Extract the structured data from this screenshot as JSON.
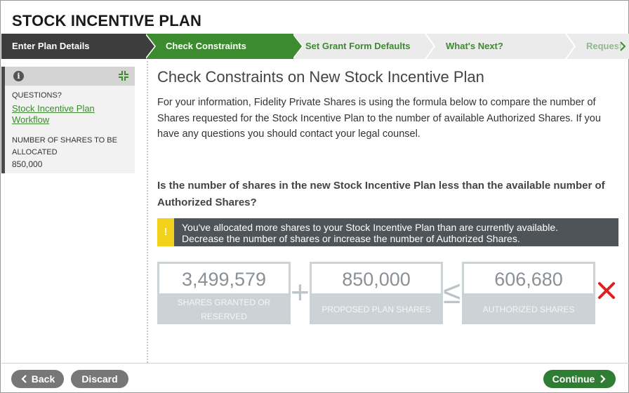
{
  "app": {
    "title": "STOCK INCENTIVE PLAN"
  },
  "stepper": {
    "steps": [
      {
        "label": "Enter Plan Details",
        "state": "done"
      },
      {
        "label": "Check Constraints",
        "state": "current"
      },
      {
        "label": "Set Grant Form Defaults",
        "state": "future"
      },
      {
        "label": "What's Next?",
        "state": "future"
      },
      {
        "label": "Request",
        "state": "future"
      }
    ],
    "overflow_icon": "chevron-right-icon"
  },
  "sidebar": {
    "info_icon": "info-icon",
    "collapse_icon": "collapse-icon",
    "questions_label": "QUESTIONS?",
    "workflow_link": "Stock Incentive Plan Workflow",
    "shares_label": "NUMBER OF SHARES TO BE ALLOCATED",
    "shares_value": "850,000"
  },
  "main": {
    "title": "Check Constraints on New Stock Incentive Plan",
    "intro": "For your information, Fidelity Private Shares is using the formula below to compare the number of Shares requested for the Stock Incentive Plan to the number of available Authorized Shares. If you have any questions you should contact your legal counsel.",
    "question": "Is the number of shares in the new Stock Incentive Plan less than the available number of Authorized Shares?",
    "warning": {
      "icon": "!",
      "line1": "You've allocated more shares to your Stock Incentive Plan than are currently available.",
      "line2": "Decrease the number of shares or increase the number of Authorized Shares."
    },
    "formula": {
      "granted": {
        "value": "3,499,579",
        "label": "SHARES GRANTED OR RESERVED"
      },
      "plus": "+",
      "proposed": {
        "value": "850,000",
        "label": "PROPOSED PLAN SHARES"
      },
      "leq": "≤",
      "authorized": {
        "value": "606,680",
        "label": "AUTHORIZED SHARES"
      },
      "result_icon": "fail-x-icon",
      "result_color": "#e02020"
    }
  },
  "footer": {
    "back_label": "Back",
    "discard_label": "Discard",
    "continue_label": "Continue"
  },
  "colors": {
    "accent_green": "#3c8b2f",
    "done_step": "#3d3d3d",
    "warning_yellow": "#f2d21a"
  }
}
